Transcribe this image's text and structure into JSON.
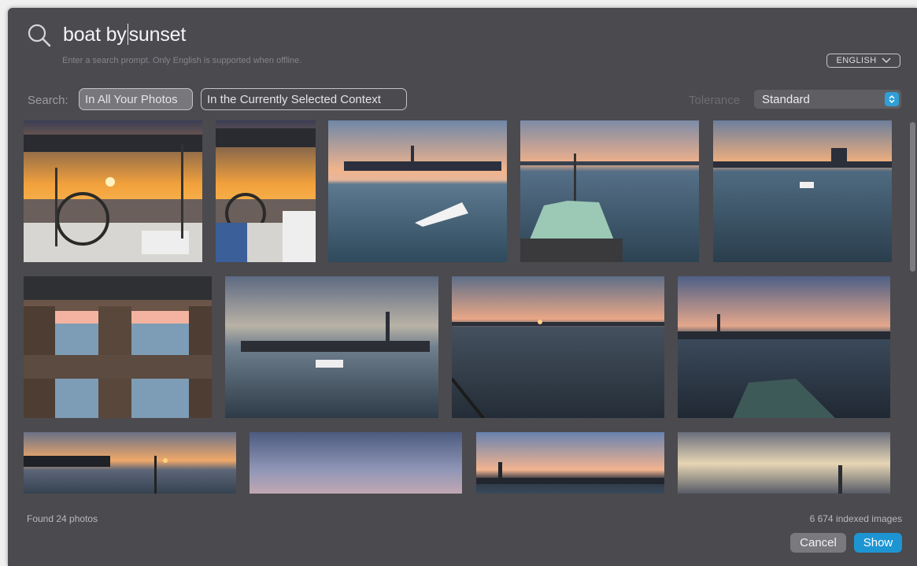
{
  "search": {
    "query_before_caret": "boat by",
    "query_after_caret": "sunset",
    "hint": "Enter a search prompt. Only English is supported when offline."
  },
  "language": {
    "selected": "ENGLISH"
  },
  "scope": {
    "label": "Search:",
    "options": [
      "In All Your Photos",
      "In the Currently Selected Context"
    ],
    "selected": "In All Your Photos"
  },
  "tolerance": {
    "label": "Tolerance",
    "selected": "Standard"
  },
  "results": {
    "count_text": "Found 24 photos",
    "indexed_text": "6 674 indexed images"
  },
  "buttons": {
    "cancel": "Cancel",
    "show": "Show"
  },
  "icons": {
    "search": "search-icon",
    "language_chevron": "chevron-down-icon",
    "tolerance_stepper": "stepper-icon"
  },
  "colors": {
    "window_bg": "#4b4a4e",
    "accent": "#1e95d3",
    "selected_scope_bg": "#78777c"
  }
}
